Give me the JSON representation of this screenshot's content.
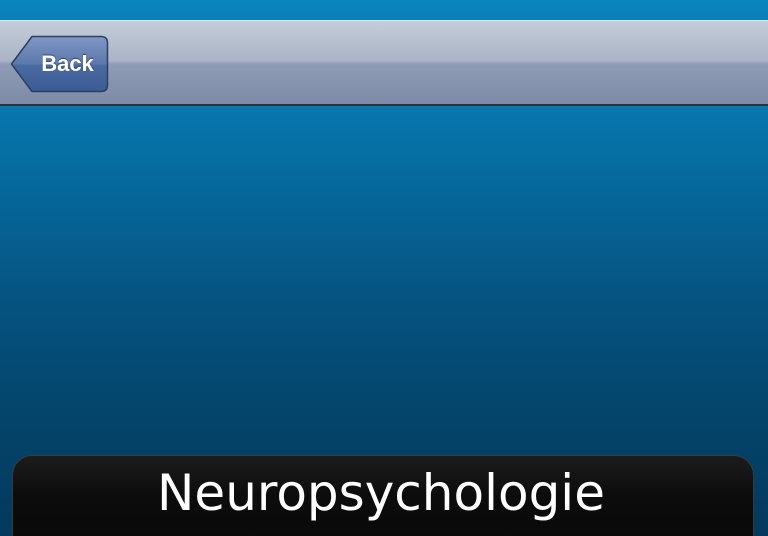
{
  "colors": {
    "background_top": "#0a7fb7",
    "background_bottom": "#03395c",
    "navbar_top": "#c5cdd9",
    "navbar_bottom": "#7c8aa7",
    "back_button_top": "#6f88b8",
    "back_button_bottom": "#3d5c96",
    "panel": "#0c0c0c",
    "title_text": "#ffffff"
  },
  "navbar": {
    "back_label": "Back",
    "back_icon": "chevron-left-icon"
  },
  "panel": {
    "title": "Neuropsychologie"
  }
}
